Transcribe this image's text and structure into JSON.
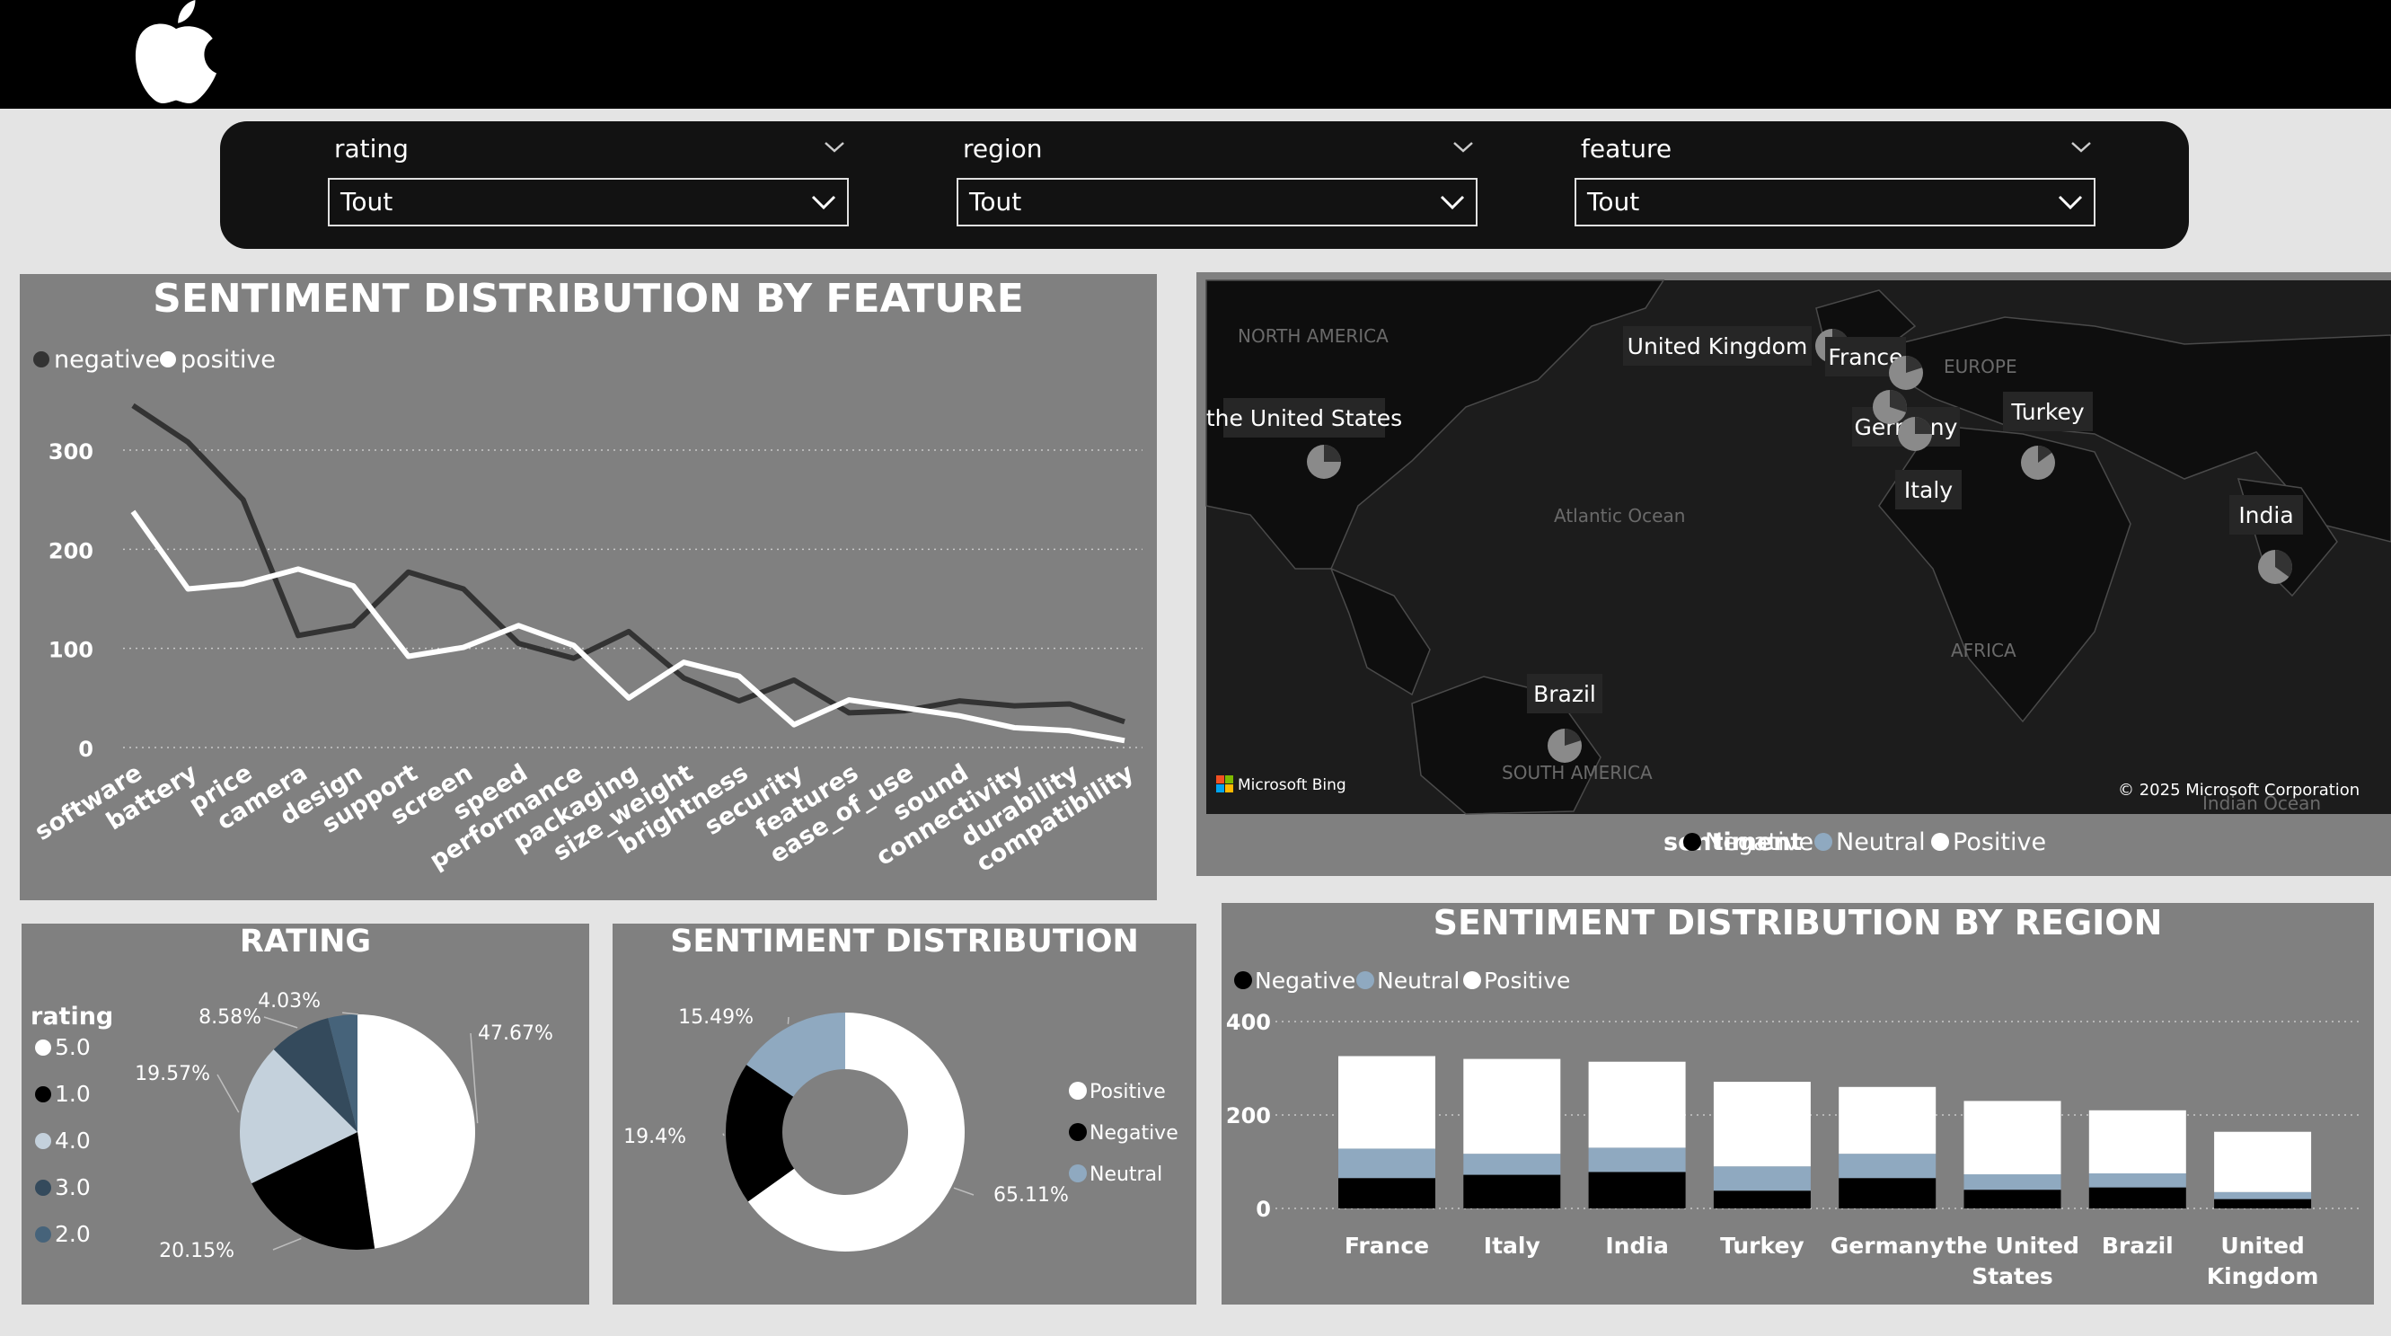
{
  "header": {
    "logo_icon": "apple-logo-icon"
  },
  "filters": [
    {
      "title": "rating",
      "value": "Tout"
    },
    {
      "title": "region",
      "value": "Tout"
    },
    {
      "title": "feature",
      "value": "Tout"
    }
  ],
  "colors": {
    "negative": "#333333",
    "positive": "#ffffff",
    "neg_solid": "#000000",
    "neutral": "#8fa9c0",
    "r3": "#344a5c",
    "r2": "#46637a",
    "panel": "#808080"
  },
  "map": {
    "labels": {
      "north_america": "NORTH AMERICA",
      "atlantic": "Atlantic Ocean",
      "europe": "EUROPE",
      "africa": "AFRICA",
      "south_america": "SOUTH AMERICA",
      "indian_ocean": "Indian Ocean"
    },
    "countries": [
      "the United States",
      "United Kingdom",
      "France",
      "Germany",
      "Italy",
      "Turkey",
      "India",
      "Brazil"
    ],
    "bing": "Microsoft Bing",
    "copyright": "© 2025 Microsoft Corporation",
    "legend_title": "sentiment",
    "legend_items": [
      "Negative",
      "Neutral",
      "Positive"
    ]
  },
  "chart_data": [
    {
      "type": "line",
      "title": "SENTIMENT DISTRIBUTION BY FEATURE",
      "categories": [
        "software",
        "battery",
        "price",
        "camera",
        "design",
        "support",
        "screen",
        "speed",
        "performance",
        "packaging",
        "size_weight",
        "brightness",
        "security",
        "features",
        "ease_of_use",
        "sound",
        "connectivity",
        "durability",
        "compatibility"
      ],
      "series": [
        {
          "name": "negative",
          "values": [
            345,
            308,
            250,
            113,
            123,
            177,
            160,
            105,
            90,
            117,
            70,
            47,
            68,
            35,
            37,
            47,
            42,
            44,
            26
          ]
        },
        {
          "name": "positive",
          "values": [
            238,
            160,
            165,
            180,
            163,
            92,
            101,
            123,
            103,
            50,
            86,
            72,
            23,
            48,
            40,
            32,
            20,
            17,
            7
          ]
        }
      ],
      "yticks": [
        0,
        100,
        200,
        300
      ],
      "ylim": [
        0,
        360
      ],
      "grid": true,
      "legend": "top-left"
    },
    {
      "type": "pie",
      "title": "RATING",
      "legend_title": "rating",
      "legend_labels": [
        "5.0",
        "1.0",
        "4.0",
        "3.0",
        "2.0"
      ],
      "values": [
        47.67,
        20.15,
        19.57,
        8.58,
        4.03
      ],
      "labels": [
        "47.67%",
        "20.15%",
        "19.57%",
        "8.58%",
        "4.03%"
      ]
    },
    {
      "type": "pie",
      "title": "SENTIMENT DISTRIBUTION",
      "legend_labels": [
        "Positive",
        "Negative",
        "Neutral"
      ],
      "values": [
        65.11,
        19.4,
        15.49
      ],
      "labels": [
        "65.11%",
        "19.4%",
        "15.49%"
      ]
    },
    {
      "type": "bar",
      "stacked": true,
      "title": "SENTIMENT DISTRIBUTION BY REGION",
      "categories": [
        "France",
        "Italy",
        "India",
        "Turkey",
        "Germany",
        "the United States",
        "Brazil",
        "United Kingdom"
      ],
      "series": [
        {
          "name": "Negative",
          "values": [
            65,
            72,
            78,
            38,
            65,
            40,
            45,
            20
          ]
        },
        {
          "name": "Neutral",
          "values": [
            63,
            45,
            52,
            52,
            52,
            33,
            30,
            15
          ]
        },
        {
          "name": "Positive",
          "values": [
            198,
            203,
            184,
            181,
            143,
            157,
            135,
            129
          ]
        }
      ],
      "yticks": [
        0,
        200,
        400
      ],
      "ylim": [
        0,
        400
      ],
      "grid": true,
      "legend": "top-left"
    }
  ]
}
